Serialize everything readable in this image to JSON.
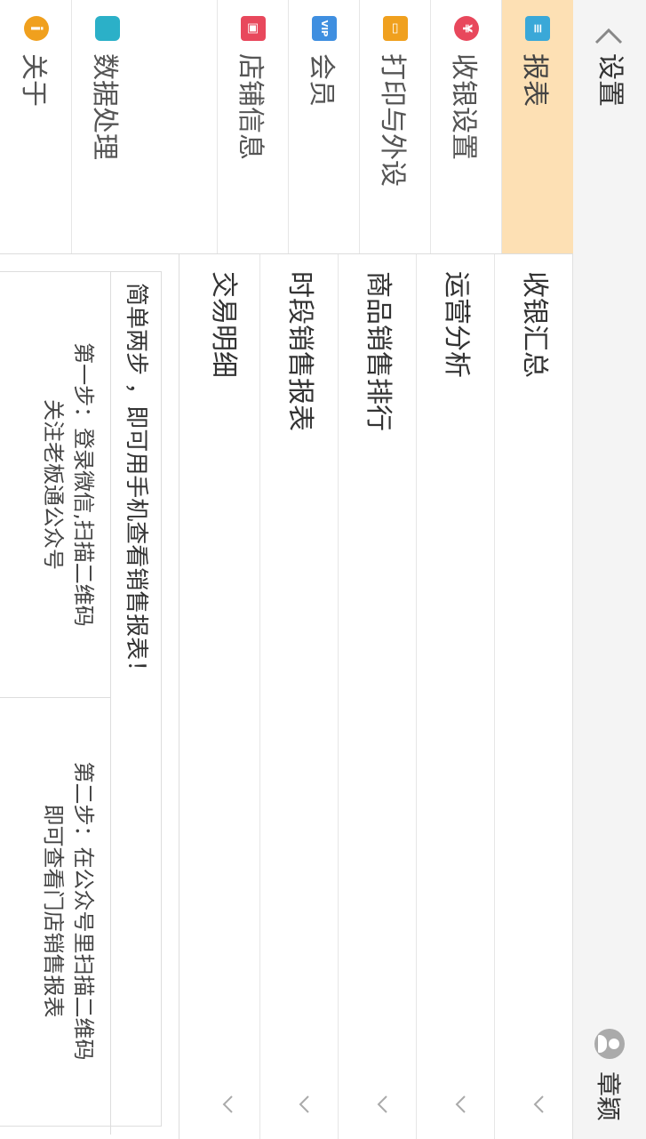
{
  "header": {
    "title": "设置",
    "username": "章颖"
  },
  "tabs": [
    {
      "label": "报表",
      "icon": "report-icon",
      "color": "#3aa8d8",
      "active": true
    },
    {
      "label": "收银设置",
      "icon": "money-bag-icon",
      "color": "#e8485c"
    },
    {
      "label": "打印与外设",
      "icon": "printer-icon",
      "color": "#f0a01e"
    },
    {
      "label": "会员",
      "icon": "vip-icon",
      "color": "#3f8fe0"
    },
    {
      "label": "店铺信息",
      "icon": "lock-icon",
      "color": "#e8485c"
    },
    {
      "label": "数据处理",
      "icon": "database-icon",
      "color": "#2bb0c8"
    },
    {
      "label": "关于",
      "icon": "info-icon",
      "color": "#f0a01e"
    }
  ],
  "report_items": [
    {
      "label": "收银汇总"
    },
    {
      "label": "运营分析"
    },
    {
      "label": "商品销售排行"
    },
    {
      "label": "时段销售报表"
    },
    {
      "label": "交易明细"
    }
  ],
  "panel": {
    "title": "简单两步 ，即可用手机查看销售报表！",
    "step1_line1": "第一步：登录微信,扫描二维码",
    "step1_line2": "关注老板通公众号",
    "step2_line1": "第二步：在公众号里扫描二维码",
    "step2_line2": "即可查看门店销售报表"
  },
  "colors": {
    "active_tab": "#fde0b4"
  }
}
